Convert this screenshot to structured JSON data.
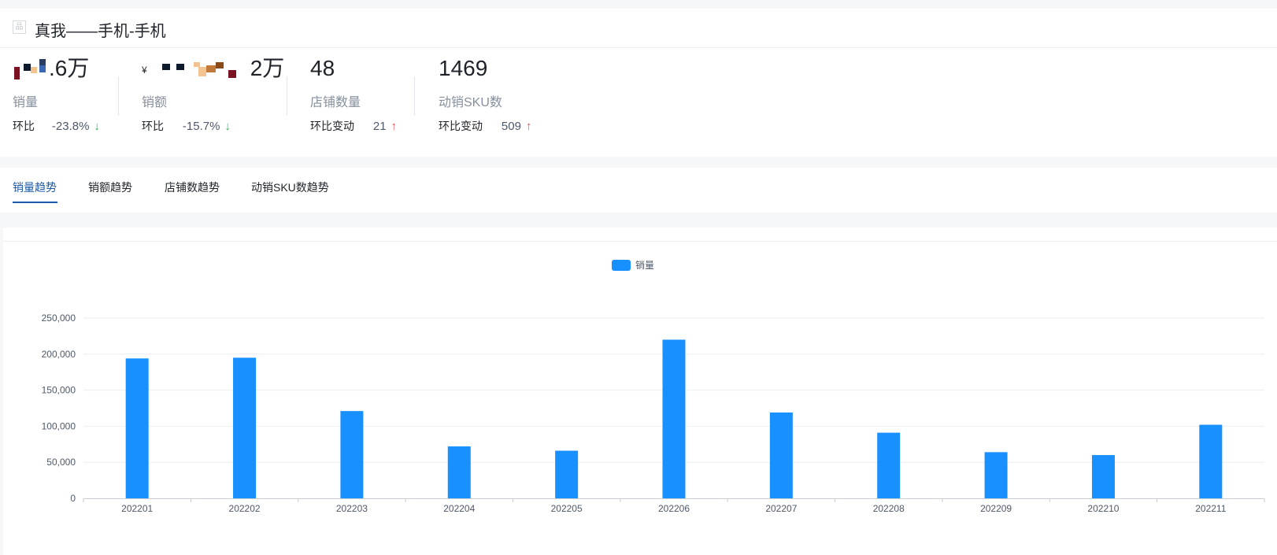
{
  "header": {
    "title": "真我——手机-手机",
    "title_icon": "品"
  },
  "metrics": [
    {
      "id": "sales-volume",
      "value_suffix": ".6万",
      "label": "销量",
      "change_label": "环比",
      "change_value": "-23.8%",
      "direction": "down"
    },
    {
      "id": "sales-amount",
      "currency": "¥",
      "value_suffix": "2万",
      "label": "销额",
      "change_label": "环比",
      "change_value": "-15.7%",
      "direction": "down"
    },
    {
      "id": "store-count",
      "value": "48",
      "label": "店铺数量",
      "change_label": "环比变动",
      "change_value": "21",
      "direction": "up"
    },
    {
      "id": "active-sku",
      "value": "1469",
      "label": "动销SKU数",
      "change_label": "环比变动",
      "change_value": "509",
      "direction": "up"
    }
  ],
  "arrows": {
    "down": "↓",
    "up": "↑"
  },
  "tabs": [
    {
      "label": "销量趋势",
      "active": true
    },
    {
      "label": "销额趋势",
      "active": false
    },
    {
      "label": "店铺数趋势",
      "active": false
    },
    {
      "label": "动销SKU数趋势",
      "active": false
    }
  ],
  "colors": {
    "accent": "#1a5aa8",
    "bar": "#1890ff",
    "down": "#2fb158",
    "up": "#f0505a"
  },
  "chart_data": {
    "type": "bar",
    "categories": [
      "202201",
      "202202",
      "202203",
      "202204",
      "202205",
      "202206",
      "202207",
      "202208",
      "202209",
      "202210",
      "202211"
    ],
    "series": [
      {
        "name": "销量",
        "values": [
          194000,
          195000,
          121000,
          72000,
          66000,
          220000,
          119000,
          91000,
          64000,
          60000,
          102000
        ]
      }
    ],
    "yticks": [
      0,
      50000,
      100000,
      150000,
      200000,
      250000
    ],
    "ytick_labels": [
      "0",
      "50,000",
      "100,000",
      "150,000",
      "200,000",
      "250,000"
    ],
    "ylim": [
      0,
      250000
    ],
    "grid": true,
    "legend": "top-center"
  }
}
